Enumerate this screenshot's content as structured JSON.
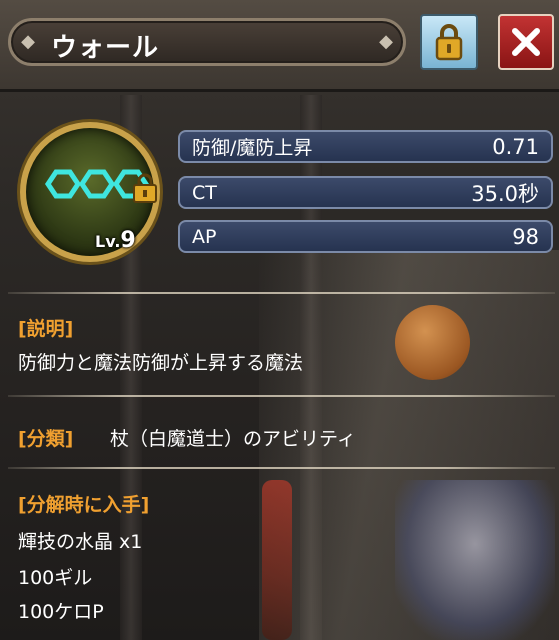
{
  "window": {
    "title": "ウォール",
    "lock_icon": "padlock-icon",
    "close_icon": "x-close-icon"
  },
  "ability": {
    "icon": "hexagon-wall-icon",
    "level_prefix": "Lv.",
    "level": "9"
  },
  "stats": [
    {
      "label": "防御/魔防上昇",
      "value": "0.71"
    },
    {
      "label": "CT",
      "value": "35.0秒"
    },
    {
      "label": "AP",
      "value": "98"
    }
  ],
  "description": {
    "heading": "[説明]",
    "text": "防御力と魔法防御が上昇する魔法"
  },
  "category": {
    "heading": "[分類]",
    "text": "杖（白魔道士）のアビリティ"
  },
  "disassemble": {
    "heading": "[分解時に入手]",
    "items": [
      "輝技の水晶 x1",
      "100ギル",
      "100ケロP"
    ]
  },
  "colors": {
    "heading": "#f0a030",
    "stat_bg": "#263350",
    "close": "#b02222",
    "lock": "#8cc4e0",
    "ring": "#c9a24a",
    "hex": "#3fe6e0"
  }
}
